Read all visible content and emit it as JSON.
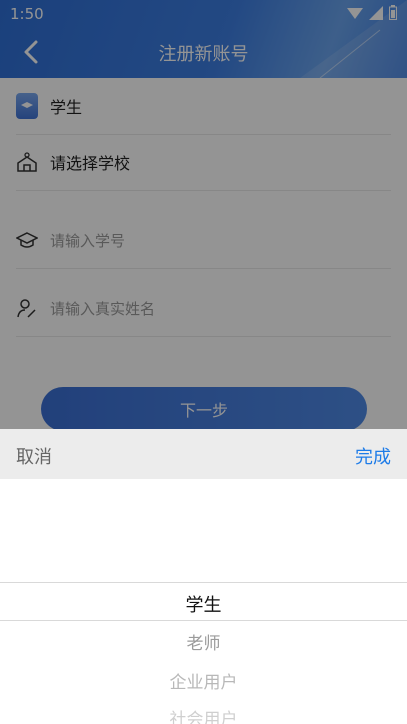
{
  "status": {
    "time": "1:50"
  },
  "header": {
    "title": "注册新账号"
  },
  "form": {
    "role": "学生",
    "school_placeholder": "请选择学校",
    "student_id_placeholder": "请输入学号",
    "name_placeholder": "请输入真实姓名",
    "next_label": "下一步"
  },
  "picker": {
    "cancel": "取消",
    "done": "完成",
    "options": [
      "学生",
      "老师",
      "企业用户",
      "社会用户"
    ],
    "selected": "学生"
  },
  "colors": {
    "accent": "#3b6fd4",
    "done": "#1e7ce8"
  }
}
